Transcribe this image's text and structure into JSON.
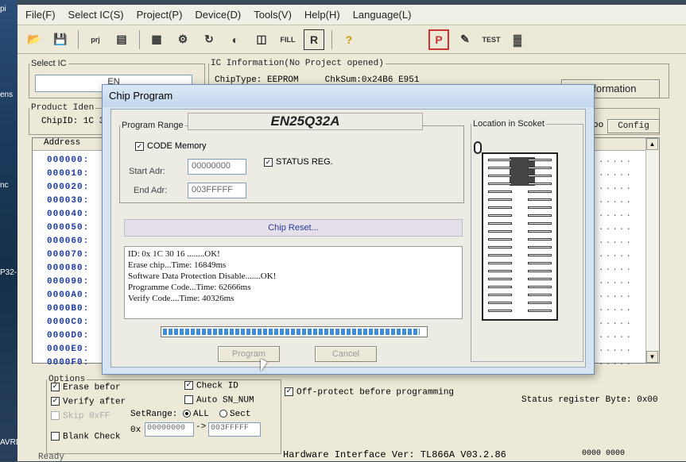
{
  "desktop": {
    "labels": [
      "pi",
      "ens",
      "nc",
      "P32-",
      "AVRD"
    ]
  },
  "menubar": {
    "items": [
      "File(F)",
      "Select IC(S)",
      "Project(P)",
      "Device(D)",
      "Tools(V)",
      "Help(H)",
      "Language(L)"
    ]
  },
  "toolbar": {
    "icons": [
      "open-icon",
      "save-icon",
      "save-project-icon",
      "load-project-icon",
      "chip-info-icon",
      "read-icon",
      "verify-icon",
      "blank-check-icon",
      "erase-icon",
      "fill-icon",
      "program-icon",
      "help-icon",
      "protect-icon",
      "edit-icon",
      "test-icon",
      "chip-icon"
    ],
    "fill_label": "FILL",
    "test_label": "TEST",
    "prj_label": "prj"
  },
  "select_ic": {
    "legend": "Select IC",
    "value": "EN"
  },
  "ic_info": {
    "legend": "IC Information(No Project opened)",
    "chip_type_label": "ChipType:",
    "chip_type": "EEPROM",
    "checksum_label": "ChkSum:",
    "checksum": "0x24B6 E951"
  },
  "info_button": {
    "label": "Information"
  },
  "product": {
    "legend": "Product Iden",
    "chip_id": "ChipID: 1C 3"
  },
  "config_button": {
    "label": "Config",
    "prefix": "oo"
  },
  "hex": {
    "header": "Address",
    "addresses": [
      "000000:",
      "000010:",
      "000020:",
      "000030:",
      "000040:",
      "000050:",
      "000060:",
      "000070:",
      "000080:",
      "000090:",
      "0000A0:",
      "0000B0:",
      "0000C0:",
      "0000D0:",
      "0000E0:",
      "0000F0:"
    ],
    "dots": "....."
  },
  "options": {
    "legend": "Options",
    "erase_before": "Erase befor",
    "verify_after": "Verify after",
    "skip_0xff": "Skip 0xFF",
    "blank_check": "Blank Check",
    "check_id": "Check ID",
    "auto_sn": "Auto SN_NUM",
    "set_range_label": "SetRange:",
    "all_label": "ALL",
    "sect_label": "Sect",
    "ox_label": "0x",
    "range_start": "00000000",
    "range_end": "003FFFFF",
    "arrow": "->"
  },
  "off_protect": {
    "label": "Off-protect before programming"
  },
  "status_reg_byte": "Status register Byte: 0x00",
  "footer": {
    "ready": "Ready",
    "hardware": "Hardware Interface Ver: TL866A V03.2.86",
    "counter": "0000 0000"
  },
  "dialog": {
    "title": "Chip Program",
    "chip_name": "EN25Q32A",
    "program_range_legend": "Program Range",
    "code_memory": "CODE Memory",
    "status_reg": "STATUS REG.",
    "start_label": "Start Adr:",
    "start_value": "00000000",
    "end_label": "End Adr:",
    "end_value": "003FFFFF",
    "location_legend": "Location in Scoket",
    "status_text": "Chip Reset...",
    "log": [
      "ID: 0x 1C 30 16 ........OK!",
      "Erase chip...Time: 16849ms",
      "Software Data Protection Disable.......OK!",
      "Programme Code...Time: 62666ms",
      "Verify Code....Time: 40326ms"
    ],
    "progress": 0.98,
    "program_button": "Program",
    "cancel_button": "Cancel"
  }
}
